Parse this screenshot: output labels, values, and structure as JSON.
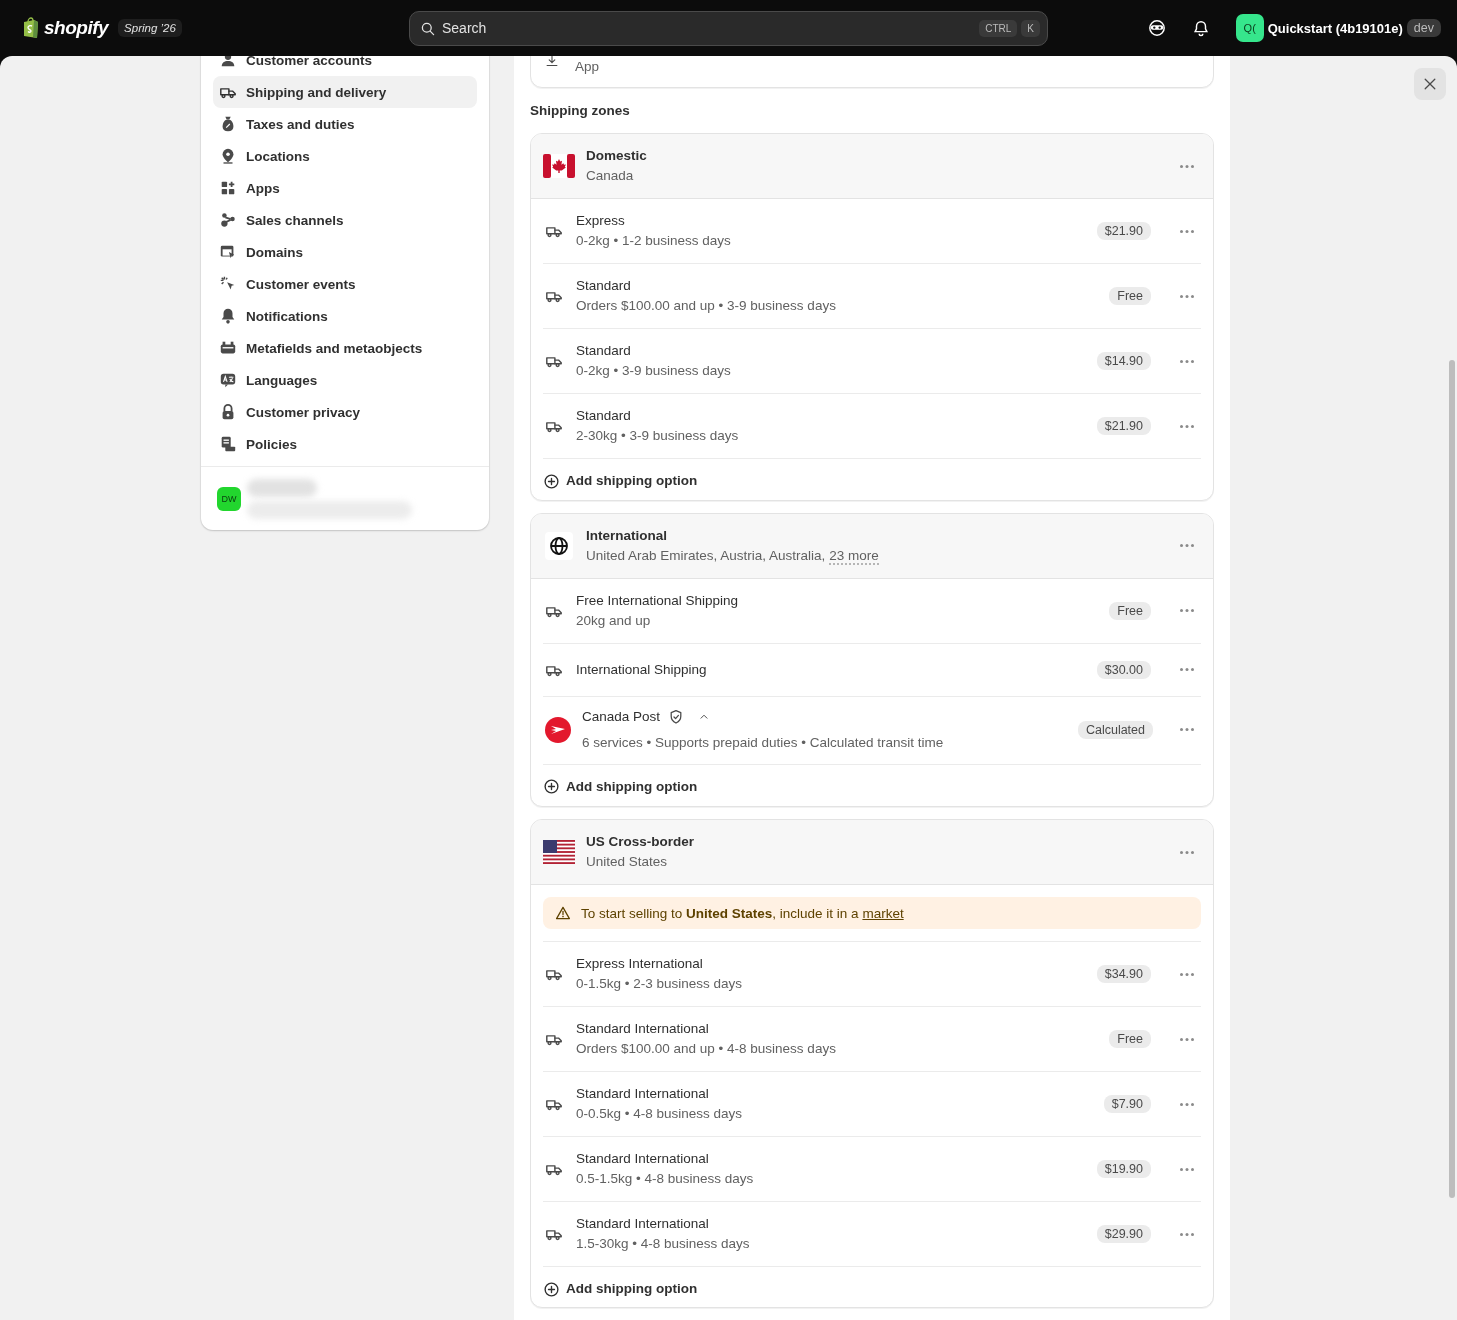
{
  "topbar": {
    "logo": "shopify",
    "edition": "Spring ’26",
    "search": {
      "placeholder": "Search",
      "shortcut": [
        "CTRL",
        "K"
      ]
    },
    "store": {
      "avatar": "Q(",
      "name": "Quickstart (4b19101e)",
      "badge": "dev"
    }
  },
  "sidebar": {
    "items": [
      {
        "label": "Customer accounts",
        "selected": false
      },
      {
        "label": "Shipping and delivery",
        "selected": true
      },
      {
        "label": "Taxes and duties",
        "selected": false
      },
      {
        "label": "Locations",
        "selected": false
      },
      {
        "label": "Apps",
        "selected": false
      },
      {
        "label": "Sales channels",
        "selected": false
      },
      {
        "label": "Domains",
        "selected": false
      },
      {
        "label": "Customer events",
        "selected": false
      },
      {
        "label": "Notifications",
        "selected": false
      },
      {
        "label": "Metafields and metaobjects",
        "selected": false
      },
      {
        "label": "Languages",
        "selected": false
      },
      {
        "label": "Customer privacy",
        "selected": false
      },
      {
        "label": "Policies",
        "selected": false
      }
    ],
    "user": {
      "avatar": "DW"
    }
  },
  "main": {
    "top_card": {
      "label": "App"
    },
    "section_title": "Shipping zones",
    "zones": [
      {
        "name": "Domestic",
        "regions": "Canada",
        "items": [
          {
            "kind": "rate",
            "name": "Express",
            "details": "0-2kg • 1-2 business days",
            "price": "$21.90"
          },
          {
            "kind": "rate",
            "name": "Standard",
            "details": "Orders $100.00 and up • 3-9 business days",
            "price": "Free"
          },
          {
            "kind": "rate",
            "name": "Standard",
            "details": "0-2kg • 3-9 business days",
            "price": "$14.90"
          },
          {
            "kind": "rate",
            "name": "Standard",
            "details": "2-30kg • 3-9 business days",
            "price": "$21.90"
          }
        ],
        "add_label": "Add shipping option"
      },
      {
        "name": "International",
        "regions": "United Arab Emirates, Austria, Australia,",
        "more": "23 more",
        "items": [
          {
            "kind": "rate",
            "name": "Free International Shipping",
            "details": "20kg and up",
            "price": "Free"
          },
          {
            "kind": "rate",
            "name": "International Shipping",
            "price": "$30.00"
          },
          {
            "kind": "carrier",
            "name": "Canada Post",
            "expanded": true,
            "details": "6 services • Supports prepaid duties • Calculated transit time",
            "price": "Calculated"
          }
        ],
        "add_label": "Add shipping option"
      },
      {
        "name": "US Cross-border",
        "regions": "United States",
        "items": [
          {
            "kind": "notice",
            "text": "To start selling to **United States**, include it in a",
            "link": "market"
          },
          {
            "kind": "rate",
            "name": "Express International",
            "details": "0-1.5kg • 2-3 business days",
            "price": "$34.90"
          },
          {
            "kind": "rate",
            "name": "Standard International",
            "details": "Orders $100.00 and up • 4-8 business days",
            "price": "Free"
          },
          {
            "kind": "rate",
            "name": "Standard International",
            "details": "0-0.5kg • 4-8 business days",
            "price": "$7.90"
          },
          {
            "kind": "rate",
            "name": "Standard International",
            "details": "0.5-1.5kg • 4-8 business days",
            "price": "$19.90"
          },
          {
            "kind": "rate",
            "name": "Standard International",
            "details": "1.5-30kg • 4-8 business days",
            "price": "$29.90"
          }
        ],
        "add_label": "Add shipping option"
      }
    ]
  }
}
